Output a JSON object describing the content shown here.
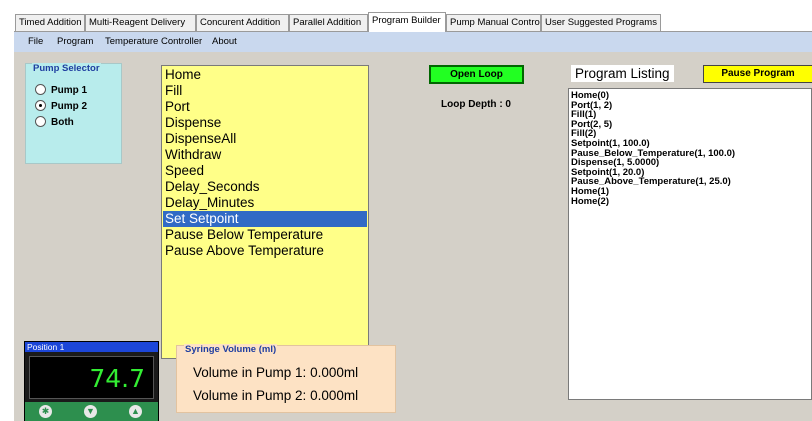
{
  "tabs": [
    {
      "label": "Timed Addition",
      "active": false
    },
    {
      "label": "Multi-Reagent Delivery",
      "active": false
    },
    {
      "label": "Concurent Addition",
      "active": false
    },
    {
      "label": "Parallel Addition",
      "active": false
    },
    {
      "label": "Program Builder",
      "active": true
    },
    {
      "label": "Pump Manual Control",
      "active": false
    },
    {
      "label": "User Suggested Programs",
      "active": false
    }
  ],
  "menu": [
    "File",
    "Program",
    "Temperature Controller",
    "About"
  ],
  "pump_selector": {
    "title": "Pump Selector",
    "options": [
      "Pump 1",
      "Pump 2",
      "Both"
    ],
    "selected": "Pump 2"
  },
  "commands": {
    "items": [
      "Home",
      "Fill",
      "Port",
      "Dispense",
      "DispenseAll",
      "Withdraw",
      "Speed",
      "Delay_Seconds",
      "Delay_Minutes",
      "Set Setpoint",
      "Pause Below Temperature",
      "Pause Above Temperature"
    ],
    "selected": "Set Setpoint"
  },
  "loop": {
    "button_label": "Open Loop",
    "depth_label": "Loop Depth : 0"
  },
  "program_listing": {
    "title": "Program Listing",
    "pause_label": "Pause Program",
    "lines": [
      "Home(0)",
      "Port(1, 2)",
      "Fill(1)",
      "Port(2, 5)",
      "Fill(2)",
      "Setpoint(1, 100.0)",
      "Pause_Below_Temperature(1, 100.0)",
      "Dispense(1, 5.0000)",
      "Setpoint(1, 20.0)",
      "Pause_Above_Temperature(1, 25.0)",
      "Home(1)",
      "Home(2)"
    ]
  },
  "controller": {
    "title": "Position 1",
    "value": "74.7",
    "buttons": [
      "asterisk-icon",
      "down-triangle-icon",
      "up-triangle-icon"
    ]
  },
  "syringe": {
    "title": "Syringe Volume (ml)",
    "pump1": "Volume in Pump 1:  0.000ml",
    "pump2": "Volume in Pump 2:  0.000ml"
  },
  "colors": {
    "command_list_bg": "#ffff88",
    "open_loop_bg": "#22ff22",
    "pause_bg": "#ffff00",
    "pump_selector_bg": "#b8ecec",
    "syringe_bg": "#fde2c4",
    "display_digits": "#33ee33",
    "selection": "#316ac5"
  }
}
